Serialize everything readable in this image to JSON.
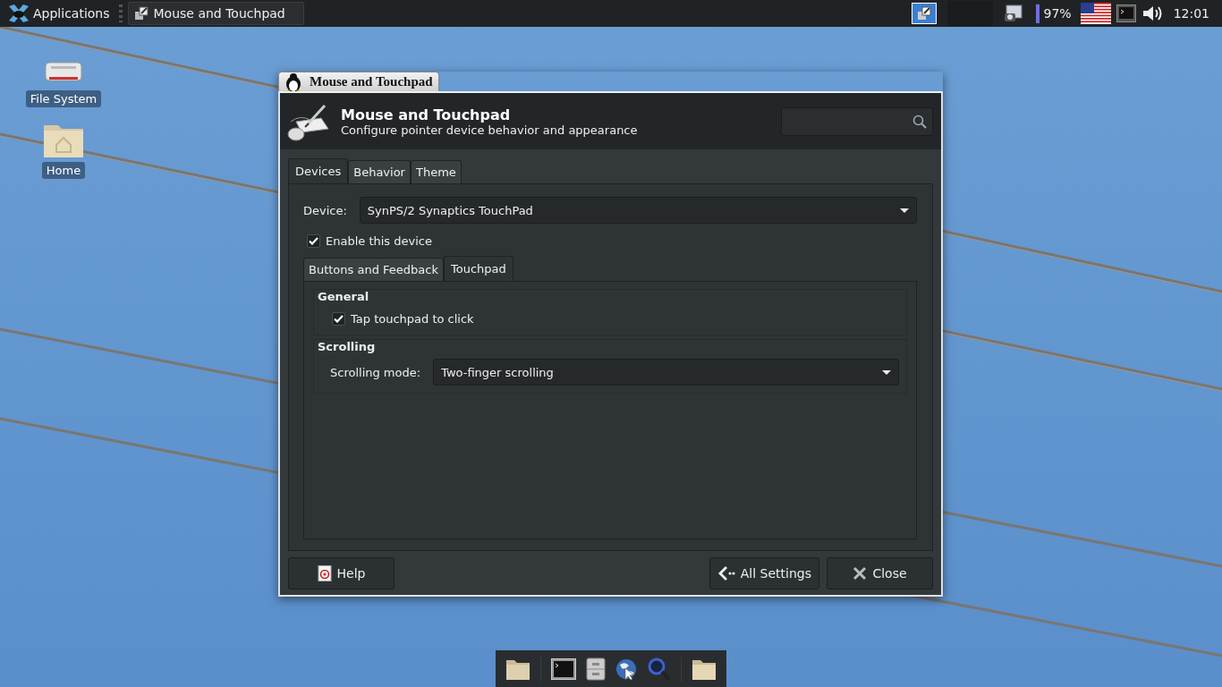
{
  "top_panel": {
    "menu_button": "Applications",
    "tasks": [
      "Mouse and Touchpad"
    ],
    "battery": {
      "level": 0.97,
      "reading": "97%"
    },
    "clock": "12:01"
  },
  "desktop_icons": [
    {
      "label": "File System",
      "kind": "drive"
    },
    {
      "label": "Home",
      "kind": "home"
    }
  ],
  "window": {
    "title": "Mouse and Touchpad",
    "header": {
      "title": "Mouse and Touchpad",
      "subtitle": "Configure pointer device behavior and appearance"
    },
    "tabs": [
      {
        "label": "Devices",
        "selected": true
      },
      {
        "label": "Behavior",
        "selected": false
      },
      {
        "label": "Theme",
        "selected": false
      }
    ],
    "device": {
      "label": "Device:",
      "value": "SynPS/2 Synaptics TouchPad"
    },
    "enable": {
      "label": "Enable this device",
      "checked": true
    },
    "subtabs": [
      {
        "label": "Buttons and Feedback",
        "selected": false
      },
      {
        "label": "Touchpad",
        "selected": true
      }
    ],
    "sections": [
      {
        "title": "General",
        "rows": [
          {
            "kind": "checkbox",
            "label": "Tap touchpad to click",
            "checked": true
          }
        ]
      },
      {
        "title": "Scrolling",
        "rows": [
          {
            "kind": "dropdown",
            "label": "Scrolling mode:",
            "value": "Two-finger scrolling"
          }
        ]
      }
    ],
    "buttons": [
      {
        "label": "Help",
        "kind": "help"
      },
      {
        "label": "All Settings",
        "kind": "back"
      },
      {
        "label": "Close",
        "kind": "close"
      }
    ]
  }
}
